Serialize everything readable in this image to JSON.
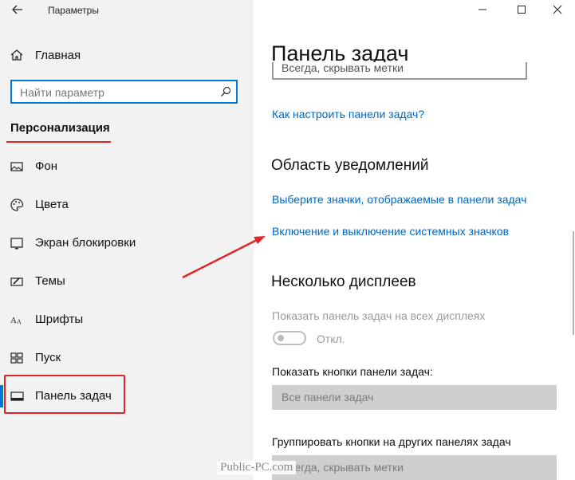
{
  "window": {
    "app_title": "Параметры",
    "back_icon": "back-arrow-icon",
    "minimize_icon": "minimize-icon",
    "maximize_icon": "maximize-icon",
    "close_icon": "close-icon"
  },
  "sidebar": {
    "home_label": "Главная",
    "search": {
      "placeholder": "Найти параметр",
      "icon": "search-icon"
    },
    "section_heading": "Персонализация",
    "items": [
      {
        "label": "Фон",
        "icon": "picture-icon"
      },
      {
        "label": "Цвета",
        "icon": "palette-icon"
      },
      {
        "label": "Экран блокировки",
        "icon": "lock-screen-icon"
      },
      {
        "label": "Темы",
        "icon": "theme-brush-icon"
      },
      {
        "label": "Шрифты",
        "icon": "font-icon"
      },
      {
        "label": "Пуск",
        "icon": "start-grid-icon"
      },
      {
        "label": "Панель задач",
        "icon": "taskbar-icon",
        "selected": true
      }
    ]
  },
  "main": {
    "title": "Панель задач",
    "top_dropdown_value": "Всегда, скрывать метки",
    "link_howto": "Как настроить панели задач?",
    "notification_area": {
      "heading": "Область уведомлений",
      "link_select_icons": "Выберите значки, отображаемые в панели задач",
      "link_system_icons": "Включение и выключение системных значков"
    },
    "multiple_displays": {
      "heading": "Несколько дисплеев",
      "show_on_all_label": "Показать панель задач на всех дисплеях",
      "toggle_state": "Откл.",
      "show_buttons_label": "Показать кнопки панели задач:",
      "show_buttons_value": "Все панели задач",
      "group_buttons_label": "Группировать кнопки на других панелях задач",
      "group_buttons_value": "Всегда, скрывать метки"
    }
  },
  "watermark": "Public-PC.com",
  "colors": {
    "accent": "#0078d7",
    "link": "#0067c0",
    "annotation_red": "#e0242a",
    "sidebar_bg": "#f2f2f2"
  }
}
